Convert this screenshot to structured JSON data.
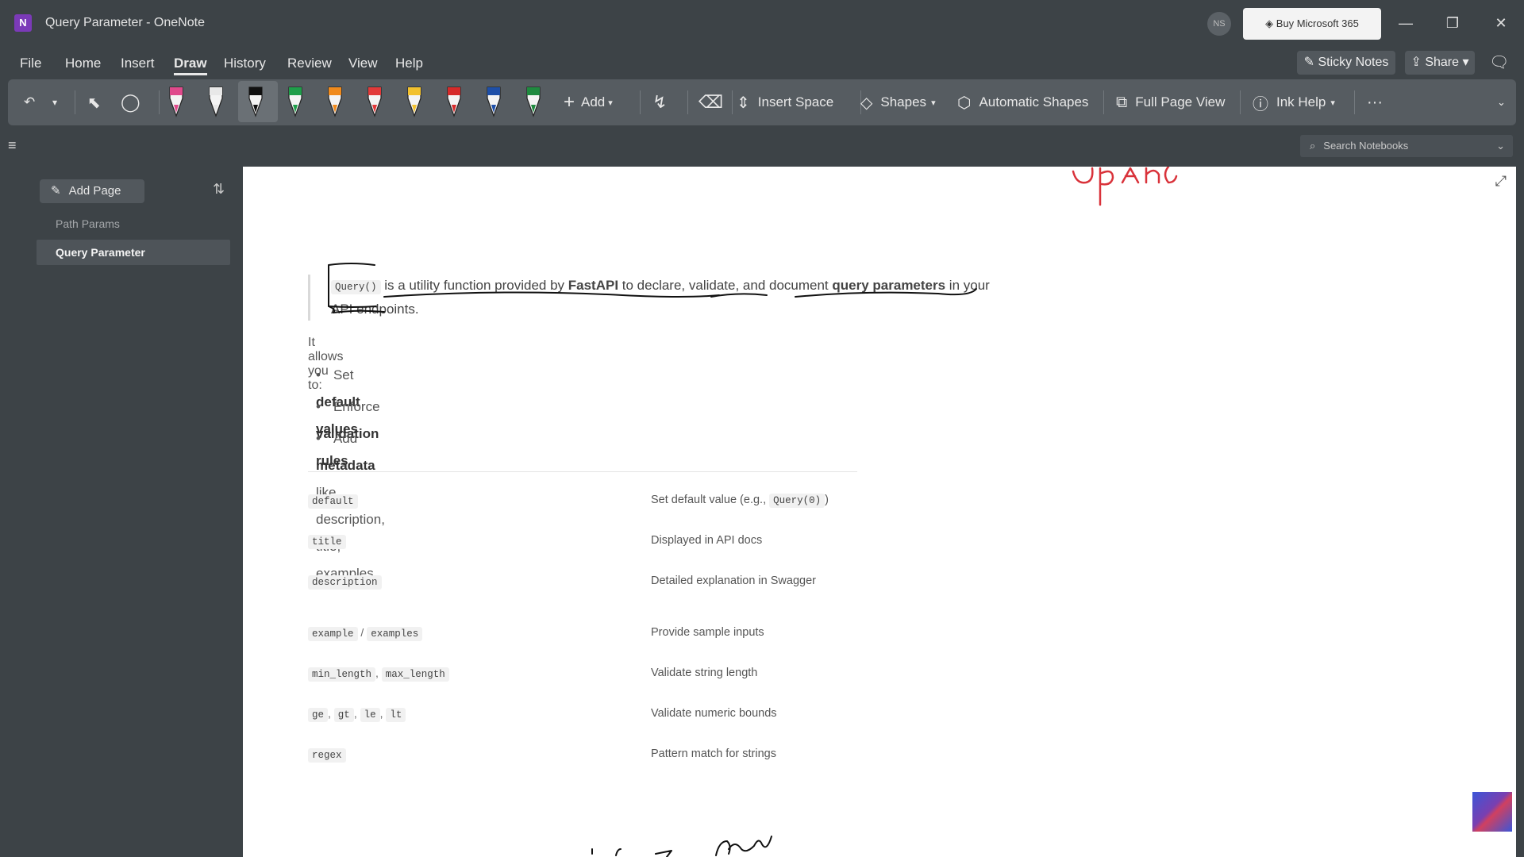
{
  "window": {
    "title": "Query Parameter - OneNote",
    "app_icon_letter": "N",
    "avatar_initials": "NS",
    "buy_label": "Buy Microsoft 365"
  },
  "menu": {
    "items": [
      "File",
      "Home",
      "Insert",
      "Draw",
      "History",
      "Review",
      "View",
      "Help"
    ],
    "active": "Draw",
    "sticky_notes": "Sticky Notes",
    "share": "Share"
  },
  "ribbon": {
    "add_label": "Add",
    "insert_space": "Insert Space",
    "shapes": "Shapes",
    "automatic_shapes": "Automatic Shapes",
    "full_page_view": "Full Page View",
    "ink_help": "Ink Help",
    "more": "···",
    "pen_colors": [
      "#e04a8c",
      "#e8e8e8",
      "#111111",
      "#1f9e4a",
      "#f08a1c",
      "#e23a3a",
      "#f2c12e",
      "#d62a2a",
      "#1e4fa8",
      "#1f8a3f"
    ]
  },
  "search": {
    "placeholder": "Search Notebooks"
  },
  "sidebar": {
    "add_page": "Add Page",
    "pages": [
      {
        "title": "Path Params",
        "selected": false
      },
      {
        "title": "Query Parameter",
        "selected": true
      }
    ]
  },
  "note": {
    "quote_code": "Query()",
    "quote_text_1": " is a utility function provided by ",
    "quote_bold_1": "FastAPI",
    "quote_text_2": " to declare, validate, and document ",
    "quote_bold_2": "query parameters",
    "quote_text_3": " in your API endpoints.",
    "allows": "It allows you to:",
    "bullets": [
      {
        "pre": "Set ",
        "bold": "default values",
        "post": ""
      },
      {
        "pre": "Enforce ",
        "bold": "validation rules",
        "post": ""
      },
      {
        "pre": "Add ",
        "bold": "metadata",
        "post": " like description, title, examples"
      }
    ],
    "table": [
      {
        "codes": [
          "default"
        ],
        "desc": "Set default value (e.g., ",
        "desc_code": "Query(0)",
        "desc_end": ")"
      },
      {
        "codes": [
          "title"
        ],
        "desc": "Displayed in API docs"
      },
      {
        "codes": [
          "description"
        ],
        "desc": "Detailed explanation in Swagger"
      },
      {
        "codes": [
          "example",
          "examples"
        ],
        "sep": " / ",
        "desc": "Provide sample inputs"
      },
      {
        "codes": [
          "min_length",
          "max_length"
        ],
        "sep": ", ",
        "desc": "Validate string length"
      },
      {
        "codes": [
          "ge",
          "gt",
          "le",
          "lt"
        ],
        "sep": ", ",
        "desc": "Validate numeric bounds"
      },
      {
        "codes": [
          "regex"
        ],
        "desc": "Pattern match for strings"
      }
    ]
  },
  "colors": {
    "chrome": "#3d4347",
    "ribbon": "#565c61",
    "canvas": "#ffffff",
    "ink_red": "#d9323a",
    "ink_black": "#111111"
  }
}
